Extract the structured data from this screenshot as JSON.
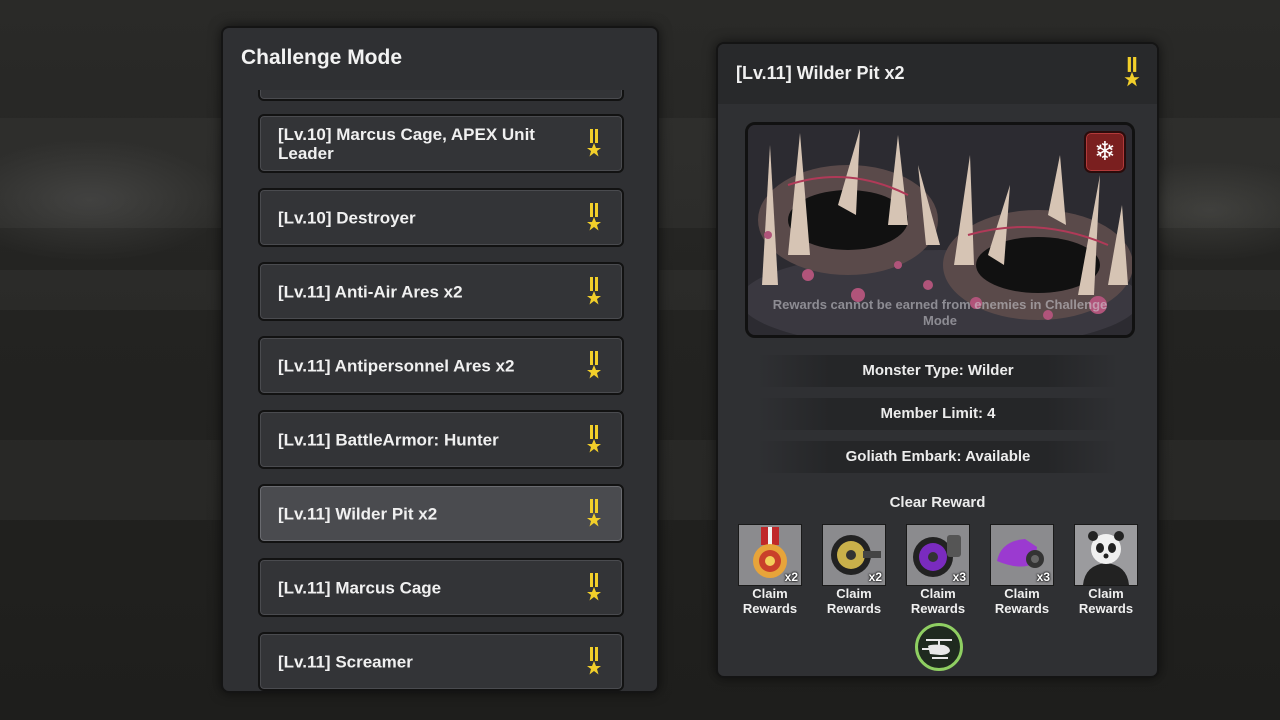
{
  "challenge_list": {
    "title": "Challenge Mode",
    "items": [
      {
        "label": "[Lv.10] Marcus Cage, APEX Unit Leader",
        "selected": false
      },
      {
        "label": "[Lv.10] Destroyer",
        "selected": false
      },
      {
        "label": "[Lv.11] Anti-Air Ares x2",
        "selected": false
      },
      {
        "label": "[Lv.11] Antipersonnel Ares x2",
        "selected": false
      },
      {
        "label": "[Lv.11] BattleArmor: Hunter",
        "selected": false
      },
      {
        "label": "[Lv.11] Wilder Pit x2",
        "selected": true
      },
      {
        "label": "[Lv.11] Marcus Cage",
        "selected": false
      },
      {
        "label": "[Lv.11] Screamer",
        "selected": false
      }
    ]
  },
  "detail": {
    "title": "[Lv.11] Wilder Pit x2",
    "preview_note": "Rewards cannot be earned from enemies in Challenge Mode",
    "freeze_icon": "snowflake-icon",
    "info": {
      "monster_type": "Monster Type: Wilder",
      "member_limit": "Member Limit: 4",
      "goliath_embark": "Goliath Embark: Available"
    },
    "reward_heading": "Clear Reward",
    "rewards": [
      {
        "icon": "medal-icon",
        "count": "x2",
        "label": "Claim Rewards"
      },
      {
        "icon": "yellow-cable-reel-icon",
        "count": "x2",
        "label": "Claim Rewards"
      },
      {
        "icon": "purple-cable-reel-icon",
        "count": "x3",
        "label": "Claim Rewards"
      },
      {
        "icon": "purple-gauntlet-icon",
        "count": "x3",
        "label": "Claim Rewards"
      },
      {
        "icon": "panda-portrait-icon",
        "count": "",
        "label": "Claim Rewards"
      }
    ],
    "action_icon": "helicopter-icon"
  },
  "colors": {
    "panel": "#2f3033",
    "medal_gold": "#f2cf2a",
    "freeze_red": "#7a1f1f",
    "heli_green": "#8fcf62"
  }
}
